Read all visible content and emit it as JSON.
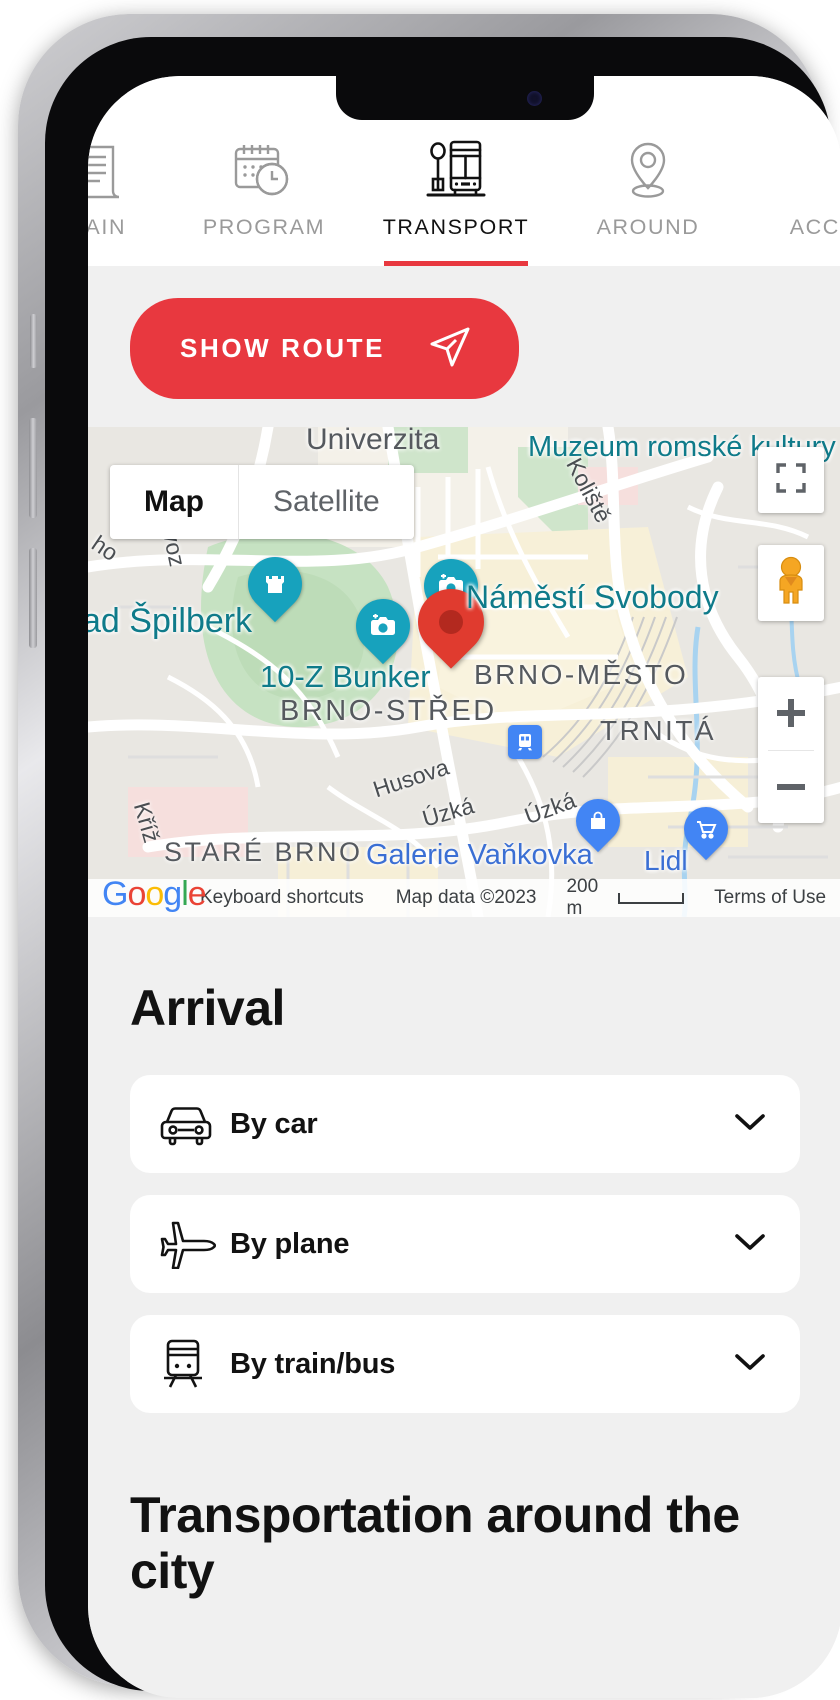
{
  "nav": {
    "tabs": [
      {
        "label": "MAIN",
        "icon": "document-icon",
        "active": false
      },
      {
        "label": "PROGRAM",
        "icon": "calendar-clock-icon",
        "active": false
      },
      {
        "label": "TRANSPORT",
        "icon": "tram-stop-icon",
        "active": true
      },
      {
        "label": "AROUND",
        "icon": "map-pin-icon",
        "active": false
      },
      {
        "label": "ACCO",
        "icon": "bed-icon",
        "active": false
      }
    ],
    "active_color": "#e8383f"
  },
  "actions": {
    "show_route_label": "SHOW ROUTE",
    "show_route_icon": "send-arrow-icon",
    "show_route_color": "#e8383f"
  },
  "map": {
    "types": [
      {
        "label": "Map",
        "selected": true
      },
      {
        "label": "Satellite",
        "selected": false
      }
    ],
    "controls": {
      "fullscreen": "fullscreen-icon",
      "pegman": "street-view-pegman-icon",
      "zoom_in": "+",
      "zoom_out": "−"
    },
    "attribution": {
      "keyboard_shortcuts": "Keyboard shortcuts",
      "map_data": "Map data ©2023",
      "scale": "200 m",
      "terms": "Terms of Use",
      "logo": "Google"
    },
    "labels": [
      {
        "text": "Univerzita",
        "style": "grey"
      },
      {
        "text": "Muzeum romské kultury",
        "style": "teal"
      },
      {
        "text": "ad Špilberk",
        "style": "teal"
      },
      {
        "text": "Náměstí Svobody",
        "style": "teal"
      },
      {
        "text": "10-Z Bunker",
        "style": "teal"
      },
      {
        "text": "BRNO-MĚSTO",
        "style": "grey"
      },
      {
        "text": "BRNO-STŘED",
        "style": "grey"
      },
      {
        "text": "TRNITÁ",
        "style": "grey"
      },
      {
        "text": "STARÉ BRNO",
        "style": "grey"
      },
      {
        "text": "Galerie Vaňkovka",
        "style": "blue"
      },
      {
        "text": "Lidl",
        "style": "blue"
      },
      {
        "text": "Koliště",
        "style": "road"
      },
      {
        "text": "Husova",
        "style": "road"
      },
      {
        "text": "Úzká",
        "style": "road"
      },
      {
        "text": "Úvoz",
        "style": "road"
      },
      {
        "text": "ho",
        "style": "road"
      },
      {
        "text": "Kříž",
        "style": "road"
      }
    ],
    "markers": [
      {
        "type": "teal-pin",
        "icon": "castle-icon"
      },
      {
        "type": "teal-pin",
        "icon": "camera-icon"
      },
      {
        "type": "teal-pin",
        "icon": "camera-icon"
      },
      {
        "type": "red-pin",
        "icon": "location-marker-icon"
      },
      {
        "type": "blue-square",
        "icon": "tram-icon"
      },
      {
        "type": "blue-pin",
        "icon": "shopping-bag-icon"
      },
      {
        "type": "blue-pin",
        "icon": "shopping-cart-icon"
      }
    ]
  },
  "arrival": {
    "title": "Arrival",
    "items": [
      {
        "label": "By car",
        "icon": "car-front-icon",
        "chevron": "chevron-down-icon"
      },
      {
        "label": "By plane",
        "icon": "plane-icon",
        "chevron": "chevron-down-icon"
      },
      {
        "label": "By train/bus",
        "icon": "train-icon",
        "chevron": "chevron-down-icon"
      }
    ]
  },
  "around_section": {
    "title": "Transportation around the city"
  }
}
